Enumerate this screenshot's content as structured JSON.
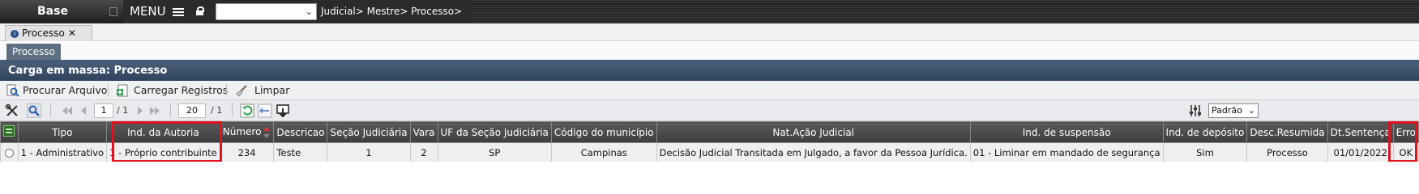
{
  "topbar": {
    "brand": "Base",
    "menu_label": "MENU",
    "select_value": "",
    "breadcrumb": "Judicial> Mestre> Processo>"
  },
  "tabs": [
    {
      "label": "Processo"
    }
  ],
  "subtab": {
    "label": "Processo"
  },
  "panel": {
    "title": "Carga em massa: Processo"
  },
  "actions": {
    "search_file": "Procurar Arquivo",
    "load_records": "Carregar Registros",
    "clear": "Limpar"
  },
  "pager": {
    "page": "1",
    "total_pages_text": "/ 1",
    "page_size": "20",
    "total_text": "/ 1",
    "view_select": "Padrão"
  },
  "table": {
    "headers": [
      "Tipo",
      "Ind. da Autoria",
      "Número",
      "Descricao",
      "Seção Judiciária",
      "Vara",
      "UF da Seção Judiciária",
      "Código do município",
      "Nat.Ação Judicial",
      "Ind. de suspensão",
      "Ind. de depósito",
      "Desc.Resumida",
      "Dt.Sentença",
      "Erro"
    ],
    "rows": [
      [
        "1 - Administrativo",
        "1 - Próprio contribuinte",
        "234",
        "Teste",
        "1",
        "2",
        "SP",
        "Campinas",
        "Decisão Judicial Transitada em Julgado, a favor da Pessoa Jurídica.",
        "01 - Liminar em mandado de segurança",
        "Sim",
        "Processo",
        "01/01/2022",
        "OK"
      ]
    ]
  },
  "colors": {
    "highlight": "#e0121b",
    "panel_header": "#3a4f6b",
    "grid_header": "#4a4a4a"
  }
}
